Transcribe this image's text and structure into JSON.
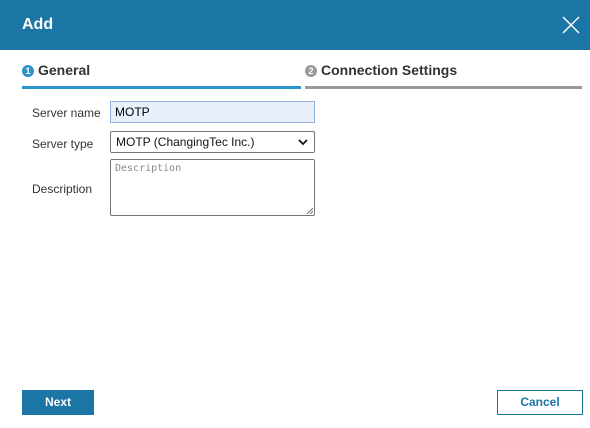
{
  "dialog": {
    "title": "Add",
    "close_icon": "close-icon"
  },
  "steps": [
    {
      "number": "1",
      "label": "General",
      "state": "active",
      "color": "#2a95c8"
    },
    {
      "number": "2",
      "label": "Connection Settings",
      "state": "inactive",
      "color": "#9a9a9a"
    }
  ],
  "form": {
    "server_name": {
      "label": "Server name",
      "value": "MOTP"
    },
    "server_type": {
      "label": "Server type",
      "selected": "MOTP (ChangingTec Inc.)"
    },
    "description": {
      "label": "Description",
      "placeholder": "Description",
      "value": ""
    }
  },
  "buttons": {
    "next_label": "Next",
    "cancel_label": "Cancel"
  },
  "colors": {
    "accent": "#1b75a5",
    "active_step": "#2a95c8",
    "inactive_step": "#9a9a9a"
  }
}
